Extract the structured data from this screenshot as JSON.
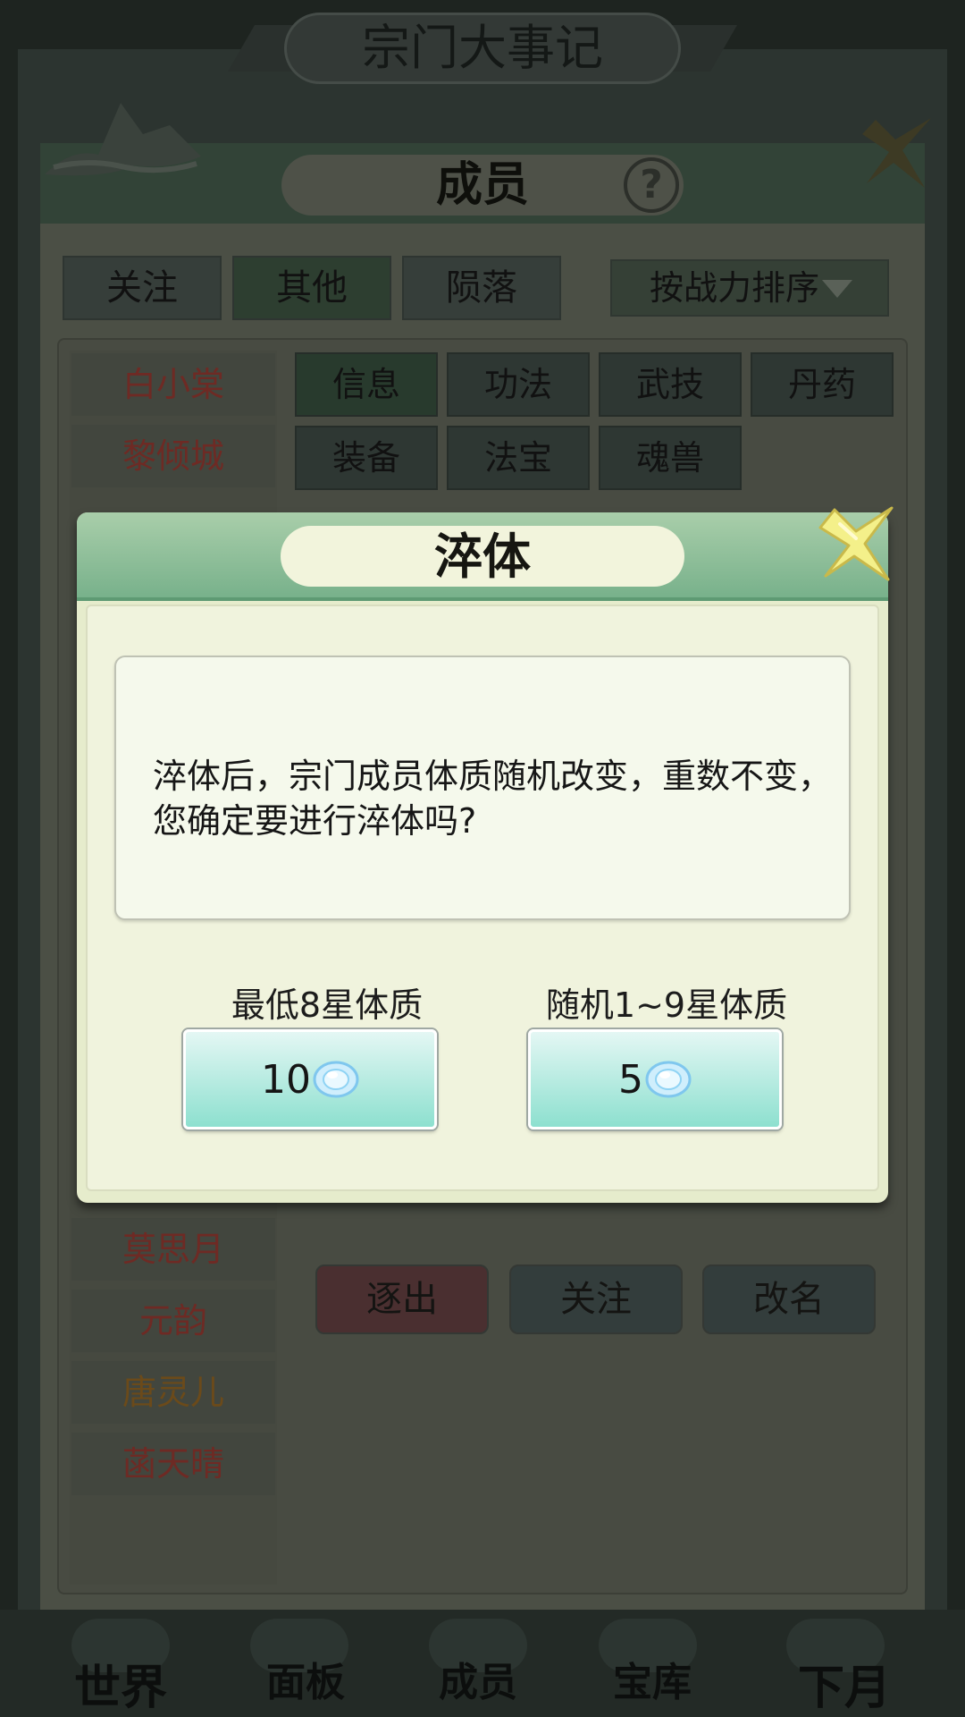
{
  "background": {
    "top_title": "宗门大事记",
    "window_title": "成员",
    "help_glyph": "?",
    "filter_tabs": [
      {
        "label": "关注"
      },
      {
        "label": "其他"
      },
      {
        "label": "陨落"
      }
    ],
    "sort_label": "按战力排序",
    "members_top": [
      {
        "name": "白小棠"
      },
      {
        "name": "黎倾城"
      }
    ],
    "members_bottom": [
      {
        "name": "莫思月"
      },
      {
        "name": "元韵"
      },
      {
        "name": "唐灵儿"
      },
      {
        "name": "菡天晴"
      }
    ],
    "info_tabs": [
      {
        "label": "信息"
      },
      {
        "label": "功法"
      },
      {
        "label": "武技"
      },
      {
        "label": "丹药"
      },
      {
        "label": "装备"
      },
      {
        "label": "法宝"
      },
      {
        "label": "魂兽"
      }
    ],
    "actions": {
      "expel": "逐出",
      "follow": "关注",
      "rename": "改名"
    },
    "bottom_nav": [
      {
        "label": "世界"
      },
      {
        "label": "面板"
      },
      {
        "label": "成员"
      },
      {
        "label": "宝库"
      },
      {
        "label": "下月"
      }
    ]
  },
  "dialog": {
    "title": "淬体",
    "message": "淬体后，宗门成员体质随机改变，重数不变，您确定要进行淬体吗?",
    "options": [
      {
        "label": "最低8星体质",
        "cost": "10",
        "currency_icon": "gem-icon"
      },
      {
        "label": "随机1~9星体质",
        "cost": "5",
        "currency_icon": "gem-icon"
      }
    ],
    "close_icon": "close-x-icon"
  },
  "colors": {
    "member_red": "#6e2a24",
    "member_orange": "#6b4a1a",
    "dialog_header": "#8fc09a",
    "cost_button": "#9ee3d4"
  }
}
